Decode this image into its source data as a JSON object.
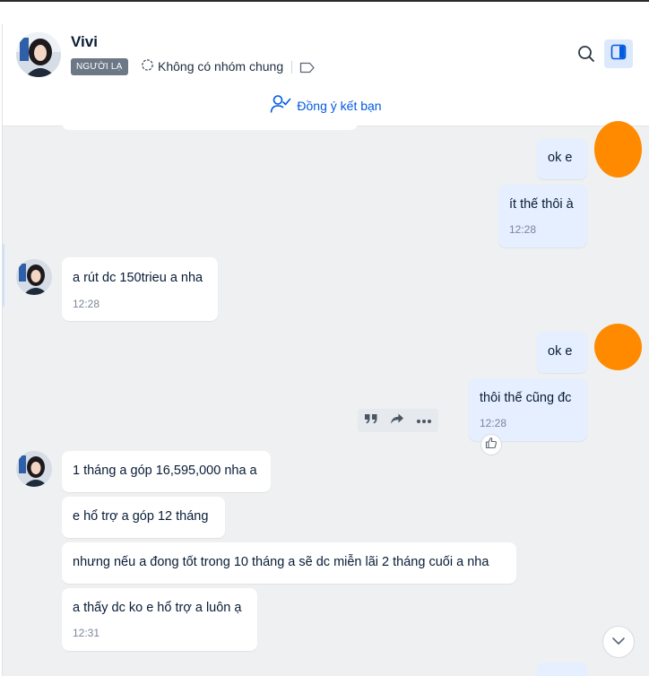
{
  "contact": {
    "name": "Vivi",
    "badge": "NGƯỜI LẠ",
    "groups": "Không có nhóm chung"
  },
  "friend_request": {
    "label": "Đồng ý kết bạn"
  },
  "messages": [
    {
      "side": "out",
      "text": "ok e"
    },
    {
      "side": "out",
      "text": "ít thế thôi à",
      "time": "12:28"
    },
    {
      "side": "in",
      "text": "a rút dc 150trieu a nha",
      "time": "12:28"
    },
    {
      "side": "out",
      "text": "ok e"
    },
    {
      "side": "out",
      "text": "thôi thế cũng đc",
      "time": "12:28"
    },
    {
      "side": "in",
      "text": "1 tháng a góp 16,595,000 nha a"
    },
    {
      "side": "in",
      "text": "e hổ trợ a góp 12 tháng"
    },
    {
      "side": "in",
      "text": "nhưng nếu a đong tốt trong 10 tháng a sẽ dc miễn lãi 2 tháng cuối a nha"
    },
    {
      "side": "in",
      "text": "a thấy dc ko e hổ trợ a luôn ạ",
      "time": "12:31"
    }
  ],
  "icons": {
    "search": "search-icon",
    "panel": "sidebar-toggle-icon",
    "tag": "tag-icon",
    "group": "group-circle-icon",
    "accept": "user-check-icon",
    "quote": "quote-icon",
    "forward": "forward-icon",
    "more": "more-icon",
    "like": "thumbs-up-icon",
    "scroll": "chevron-down-icon"
  },
  "colors": {
    "accent": "#005ae0",
    "outgoing_bubble": "#e5efff",
    "incoming_bubble": "#ffffff",
    "chat_background": "#eef0f1",
    "badge_background": "#6d7886",
    "redaction": "#ff8a00"
  }
}
